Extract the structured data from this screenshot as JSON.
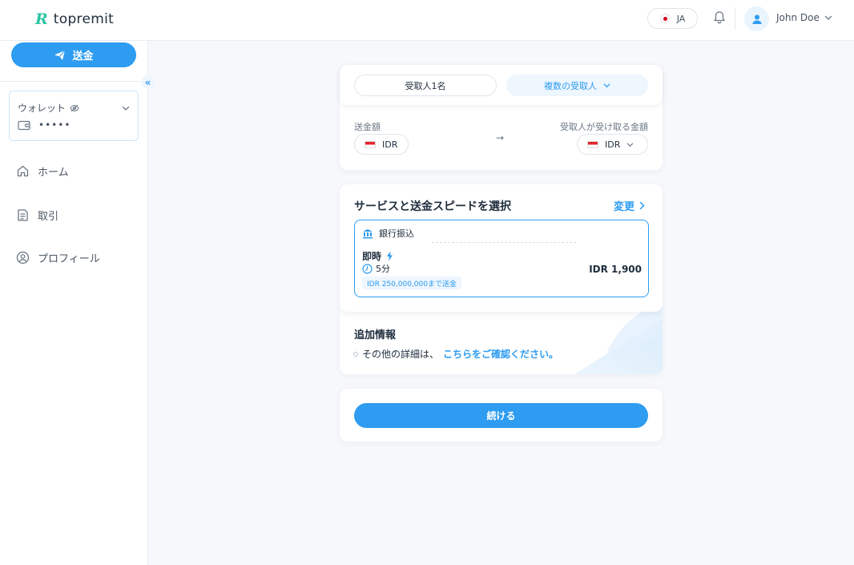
{
  "header": {
    "logo_mark": "R",
    "logo_text": "topremit",
    "language": "JA",
    "user_name": "John Doe"
  },
  "sidebar": {
    "send_button": "送金",
    "collapse": "«",
    "wallet": {
      "label": "ウォレット",
      "masked_balance": "•••••"
    },
    "nav": [
      {
        "label": "ホーム",
        "icon": "home-icon"
      },
      {
        "label": "取引",
        "icon": "transactions-icon"
      },
      {
        "label": "プロフィール",
        "icon": "profile-icon"
      }
    ]
  },
  "recipient_tabs": {
    "single": "受取人1名",
    "multiple": "複数の受取人"
  },
  "amounts": {
    "send_label": "送金額",
    "send_currency": "IDR",
    "receive_label": "受取人が受け取る金額",
    "receive_currency": "IDR",
    "arrow": "→"
  },
  "service": {
    "title": "サービスと送金スピードを選択",
    "change": "変更",
    "method": "銀行振込",
    "speed": "即時",
    "time": "5分",
    "limit": "IDR 250,000,000まで送金",
    "fee": "IDR 1,900"
  },
  "additional": {
    "title": "追加情報",
    "text": "その他の詳細は、",
    "link": "こちらをご確認ください。"
  },
  "continue_button": "続ける",
  "colors": {
    "accent": "#2d9cf1",
    "brand": "#2bc4a4"
  }
}
